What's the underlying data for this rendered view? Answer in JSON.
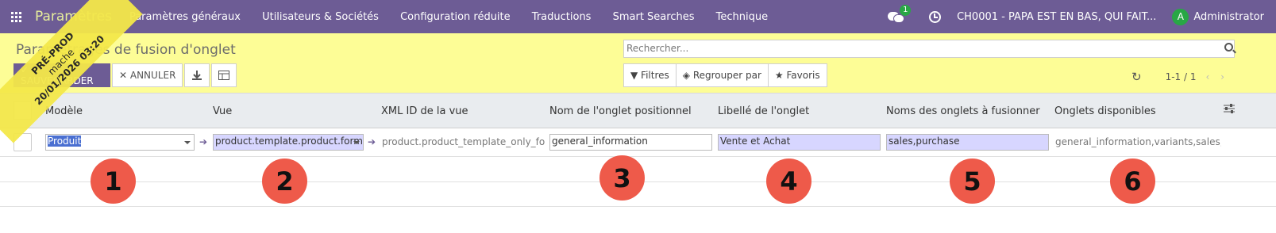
{
  "topbar": {
    "app_name": "Paramètres",
    "menu": [
      "Paramètres généraux",
      "Utilisateurs & Sociétés",
      "Configuration réduite",
      "Traductions",
      "Smart Searches",
      "Technique"
    ],
    "chat_badge": "1",
    "company": "CH0001 - PAPA EST EN BAS, QUI FAIT...",
    "avatar_letter": "A",
    "user": "Administrator"
  },
  "control_panel": {
    "title": "Paramétrages de fusion d'onglet",
    "save_label": "✓ SAUVEGARDER",
    "cancel_label": "✕ ANNULER",
    "search_placeholder": "Rechercher...",
    "filters_label": "Filtres",
    "group_label": "Regrouper par",
    "favorites_label": "Favoris",
    "pager": "1-1 / 1"
  },
  "ribbon": {
    "line1": "PRÉ-PROD",
    "line2": "mache",
    "line3": "20/01/2026 03:20"
  },
  "table": {
    "headers": [
      "Modèle",
      "Vue",
      "XML ID de la vue",
      "Nom de l'onglet positionnel",
      "Libellé de l'onglet",
      "Noms des onglets à fusionner",
      "Onglets disponibles"
    ],
    "row": {
      "model": "Produit",
      "view": "product.template.product.form",
      "xml_id": "product.product_template_only_form_view",
      "tab_name": "general_information",
      "tab_label": "Vente et Achat",
      "merge_tabs": "sales,purchase",
      "available_tabs": "general_information,variants,sales,purchase"
    }
  },
  "markers": [
    "1",
    "2",
    "3",
    "4",
    "5",
    "6"
  ],
  "colors": {
    "topbar": "#6d5c95",
    "control_panel": "#fdfd96",
    "marker": "#ee5a4a"
  }
}
